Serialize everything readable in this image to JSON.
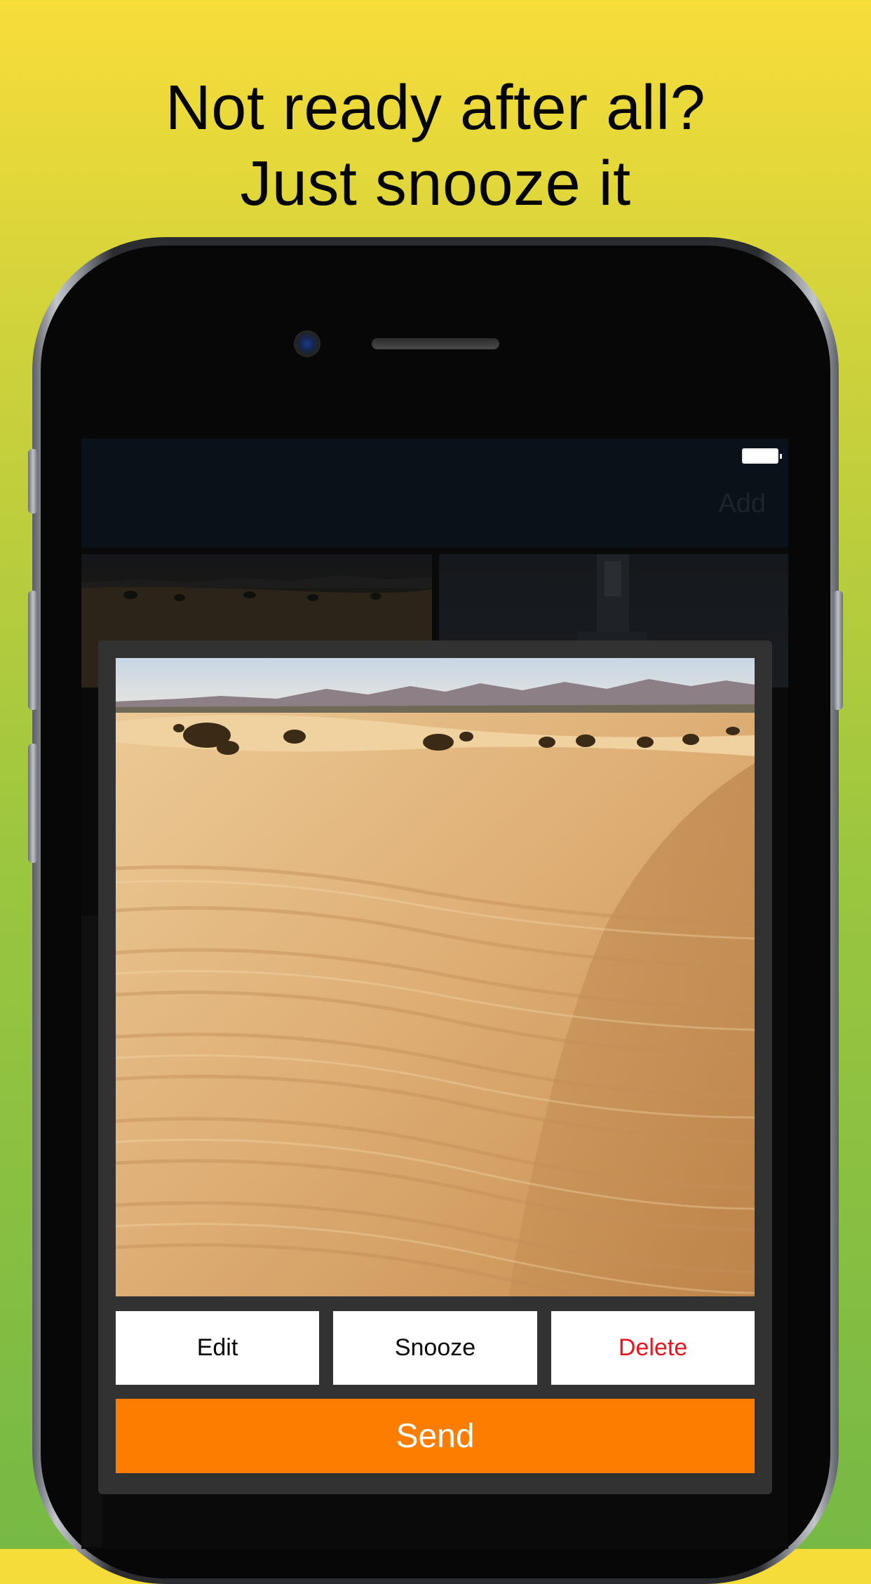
{
  "headline": {
    "line1": "Not ready after all?",
    "line2": "Just snooze it"
  },
  "app": {
    "nav_add_label": "Add"
  },
  "dialog": {
    "image": "desert-dunes-photo",
    "buttons": {
      "edit": "Edit",
      "snooze": "Snooze",
      "delete": "Delete",
      "send": "Send"
    }
  },
  "colors": {
    "background_top": "#f8dd3a",
    "background_bottom": "#76b944",
    "send": "#fd7d00",
    "delete_text": "#e5161e",
    "dialog": "#323232",
    "navbar": "#0b1119"
  }
}
